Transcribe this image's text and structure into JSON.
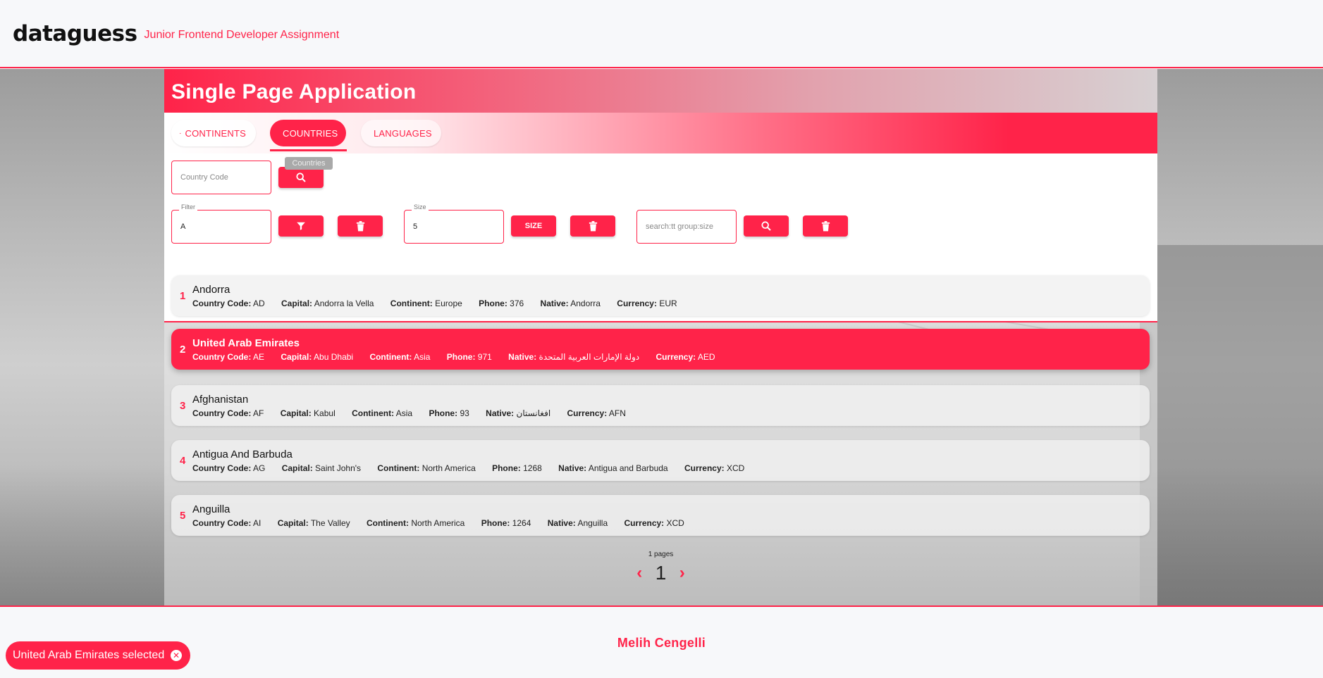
{
  "header": {
    "logo": "dataguess",
    "subtitle": "Junior Frontend Developer Assignment"
  },
  "banner": {
    "title": "Single Page Application"
  },
  "tabs": [
    {
      "label": "CONTINENTS",
      "icon": "globe-icon",
      "active": false
    },
    {
      "label": "COUNTRIES",
      "icon": "globe-icon",
      "active": true
    },
    {
      "label": "LANGUAGES",
      "icon": "translate-icon",
      "active": false
    }
  ],
  "tooltip": "Countries",
  "search": {
    "country_code_placeholder": "Country Code",
    "filter_label": "Filter",
    "filter_value": "A",
    "size_label": "Size",
    "size_value": "5",
    "size_button": "SIZE",
    "group_placeholder": "search:tt group:size"
  },
  "field_labels": {
    "code": "Country Code:",
    "capital": "Capital:",
    "continent": "Continent:",
    "phone": "Phone:",
    "native": "Native:",
    "currency": "Currency:"
  },
  "countries": [
    {
      "index": "1",
      "name": "Andorra",
      "code": "AD",
      "capital": "Andorra la Vella",
      "continent": "Europe",
      "phone": "376",
      "native": "Andorra",
      "currency": "EUR",
      "selected": false
    },
    {
      "index": "2",
      "name": "United Arab Emirates",
      "code": "AE",
      "capital": "Abu Dhabi",
      "continent": "Asia",
      "phone": "971",
      "native": "دولة الإمارات العربية المتحدة",
      "currency": "AED",
      "selected": true
    },
    {
      "index": "3",
      "name": "Afghanistan",
      "code": "AF",
      "capital": "Kabul",
      "continent": "Asia",
      "phone": "93",
      "native": "افغانستان",
      "currency": "AFN",
      "selected": false
    },
    {
      "index": "4",
      "name": "Antigua And Barbuda",
      "code": "AG",
      "capital": "Saint John's",
      "continent": "North America",
      "phone": "1268",
      "native": "Antigua and Barbuda",
      "currency": "XCD",
      "selected": false
    },
    {
      "index": "5",
      "name": "Anguilla",
      "code": "AI",
      "capital": "The Valley",
      "continent": "North America",
      "phone": "1264",
      "native": "Anguilla",
      "currency": "XCD",
      "selected": false
    }
  ],
  "pagination": {
    "pages_label": "1 pages",
    "current_page": "1"
  },
  "footer": {
    "author": "Melih Cengelli"
  },
  "snackbar": {
    "message": "United Arab Emirates selected"
  },
  "colors": {
    "accent": "#ff2349"
  }
}
